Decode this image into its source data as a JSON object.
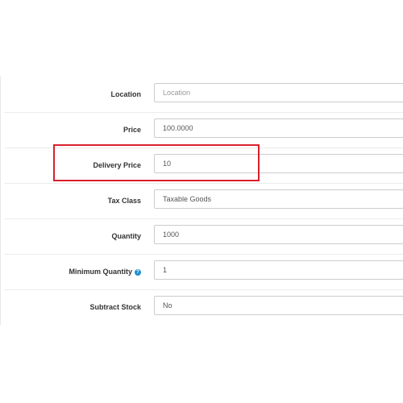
{
  "form": {
    "location": {
      "label": "Location",
      "placeholder": "Location",
      "value": ""
    },
    "price": {
      "label": "Price",
      "value": "100.0000"
    },
    "delivery_price": {
      "label": "Delivery Price",
      "value": "10"
    },
    "tax_class": {
      "label": "Tax Class",
      "value": "Taxable Goods"
    },
    "quantity": {
      "label": "Quantity",
      "value": "1000"
    },
    "minimum_quantity": {
      "label": "Minimum Quantity",
      "help_icon": "question-circle-icon",
      "value": "1"
    },
    "subtract_stock": {
      "label": "Subtract Stock",
      "value": "No"
    }
  },
  "colors": {
    "highlight": "#d9202c",
    "help_icon": "#1e91cf"
  }
}
